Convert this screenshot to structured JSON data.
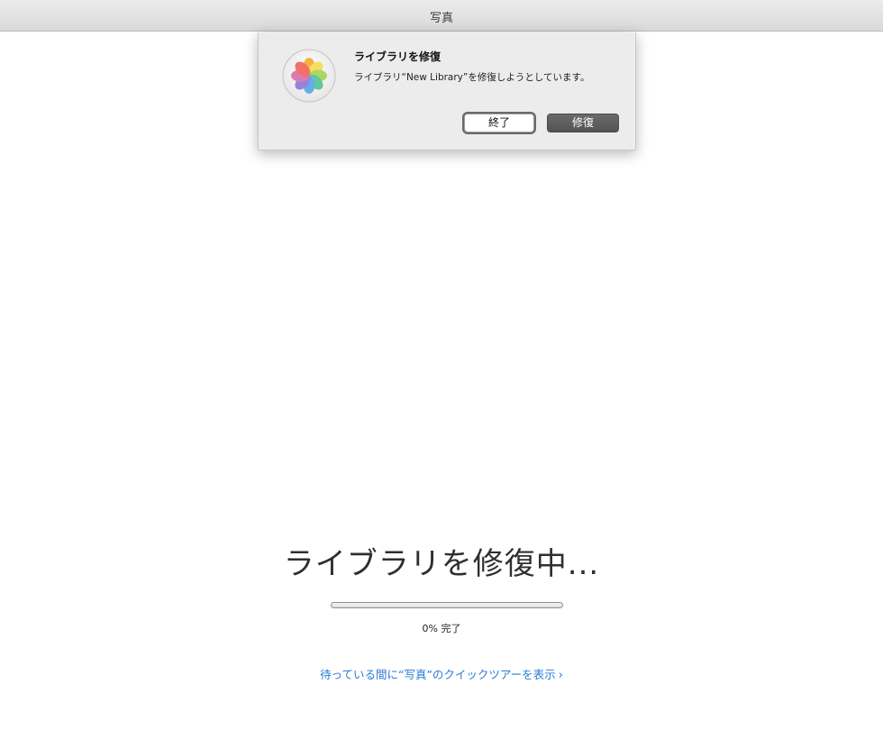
{
  "window": {
    "title": "写真"
  },
  "dialog": {
    "title": "ライブラリを修復",
    "message": "ライブラリ“New Library”を修復しようとしています。",
    "quit_label": "終了",
    "repair_label": "修復",
    "icon": "photos-app-icon"
  },
  "main": {
    "heading": "ライブラリを修復中...",
    "progress": 0,
    "progress_text": "0% 完了",
    "tour_link": "待っている間に“写真”のクイックツアーを表示",
    "tour_link_icon": "chevron-right-icon"
  },
  "colors": {
    "link": "#2a7ad8",
    "titlebar": "#dddddd",
    "dialog_bg": "#ececec",
    "default_button": "#5e5e5e"
  }
}
